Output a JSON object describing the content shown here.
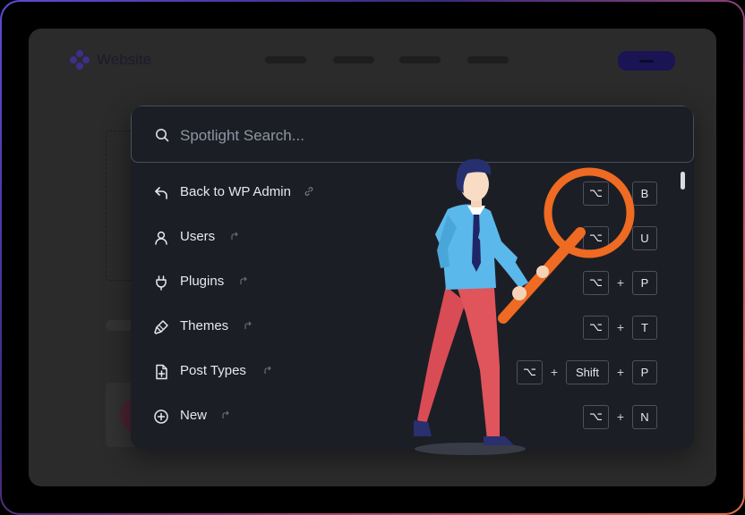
{
  "site": {
    "name": "Website"
  },
  "search": {
    "placeholder": "Spotlight Search...",
    "value": ""
  },
  "commands": [
    {
      "label": "Back to WP Admin",
      "icon": "arrow-back-icon",
      "ext_icon": "link-icon",
      "keys": [
        "⌥",
        "B"
      ]
    },
    {
      "label": "Users",
      "icon": "user-icon",
      "ext_icon": "external-icon",
      "keys": [
        "⌥",
        "U"
      ]
    },
    {
      "label": "Plugins",
      "icon": "plug-icon",
      "ext_icon": "external-icon",
      "keys": [
        "⌥",
        "+",
        "P"
      ]
    },
    {
      "label": "Themes",
      "icon": "brush-icon",
      "ext_icon": "external-icon",
      "keys": [
        "⌥",
        "+",
        "T"
      ]
    },
    {
      "label": "Post Types",
      "icon": "file-plus-icon",
      "ext_icon": "external-icon",
      "keys": [
        "⌥",
        "+",
        "Shift",
        "+",
        "P"
      ]
    },
    {
      "label": "New",
      "icon": "plus-circle-icon",
      "ext_icon": "external-icon",
      "keys": [
        "⌥",
        "+",
        "N"
      ]
    }
  ],
  "colors": {
    "panel_bg": "#1c1e25",
    "magnifier": "#ef6a22",
    "shirt": "#5bb8ea",
    "pants": "#e0545c",
    "frame_gradient_start": "#5b4bd6",
    "frame_gradient_end": "#e0734f"
  }
}
